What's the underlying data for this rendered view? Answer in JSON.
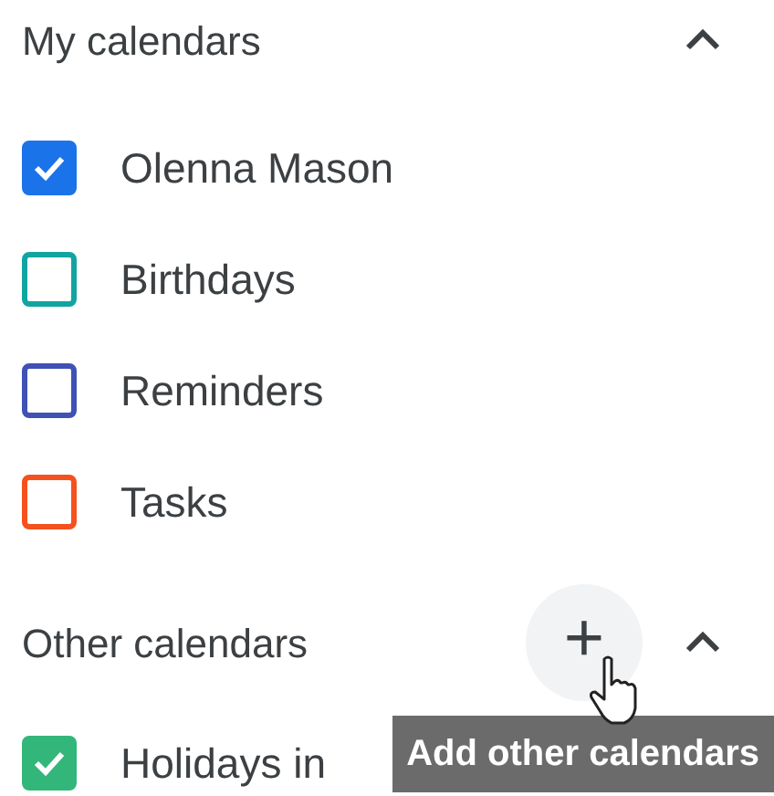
{
  "sections": [
    {
      "title": "My calendars",
      "expanded": true,
      "calendars": [
        {
          "name": "Olenna Mason",
          "color": "#1a73e8",
          "checked": true
        },
        {
          "name": "Birthdays",
          "color": "#12a4a0",
          "checked": false
        },
        {
          "name": "Reminders",
          "color": "#3f51b5",
          "checked": false
        },
        {
          "name": "Tasks",
          "color": "#f4511e",
          "checked": false
        }
      ]
    },
    {
      "title": "Other calendars",
      "expanded": true,
      "add_button": {
        "symbol": "+",
        "tooltip": "Add other calendars"
      },
      "calendars": [
        {
          "name": "Holidays in",
          "color": "#33b679",
          "checked": true
        }
      ]
    }
  ]
}
